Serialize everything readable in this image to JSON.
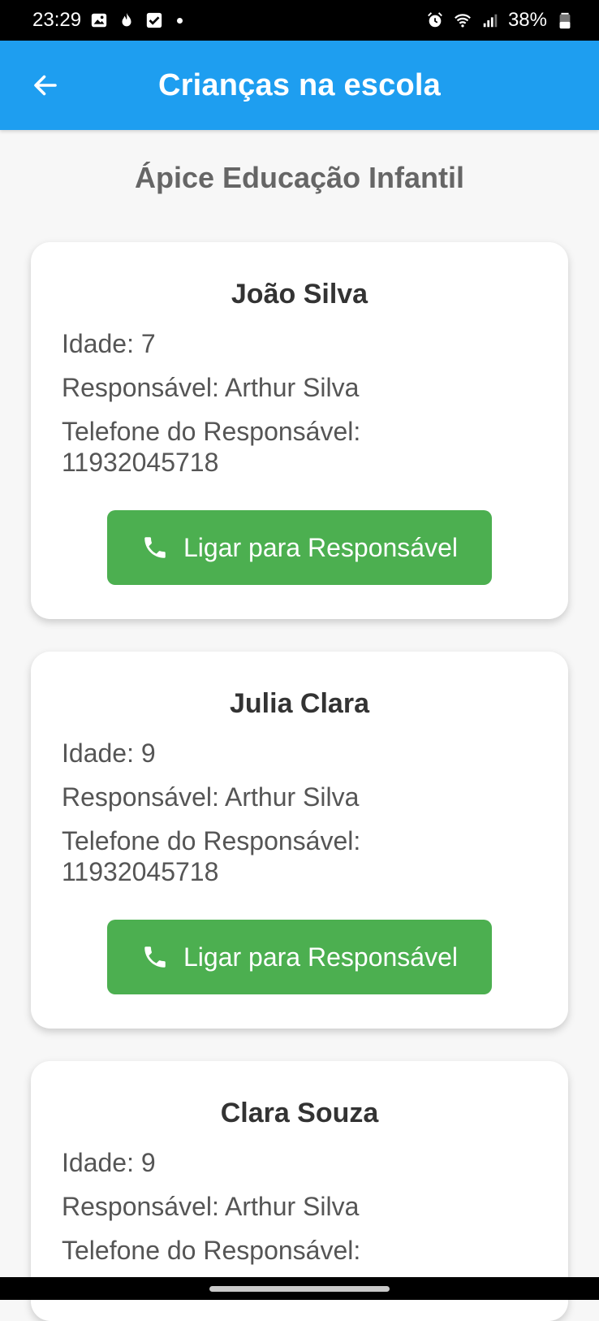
{
  "status_bar": {
    "time": "23:29",
    "battery": "38%",
    "left_icons": [
      "gallery-icon",
      "tinder-flame-icon",
      "checkbox-icon",
      "notification-dot"
    ],
    "right_icons": [
      "alarm-icon",
      "wifi-icon",
      "signal-icon",
      "battery-icon"
    ]
  },
  "app_bar": {
    "title": "Crianças na escola",
    "back_icon": "arrow-left-icon",
    "color": "#1e9ef0"
  },
  "school": {
    "name": "Ápice Educação Infantil"
  },
  "children": [
    {
      "name": "João Silva",
      "age_label": "Idade: 7",
      "guardian_label": "Responsável: Arthur Silva",
      "phone_label": "Telefone do Responsável:",
      "phone": "11932045718",
      "button_label": "Ligar para Responsável"
    },
    {
      "name": "Julia Clara",
      "age_label": "Idade: 9",
      "guardian_label": "Responsável: Arthur Silva",
      "phone_label": "Telefone do Responsável:",
      "phone": "11932045718",
      "button_label": "Ligar para Responsável"
    },
    {
      "name": "Clara Souza",
      "age_label": "Idade: 9",
      "guardian_label": "Responsável: Arthur Silva",
      "phone_label": "Telefone do Responsável:"
    }
  ],
  "colors": {
    "call_button": "#4caf50",
    "background": "#f7f7f7"
  }
}
